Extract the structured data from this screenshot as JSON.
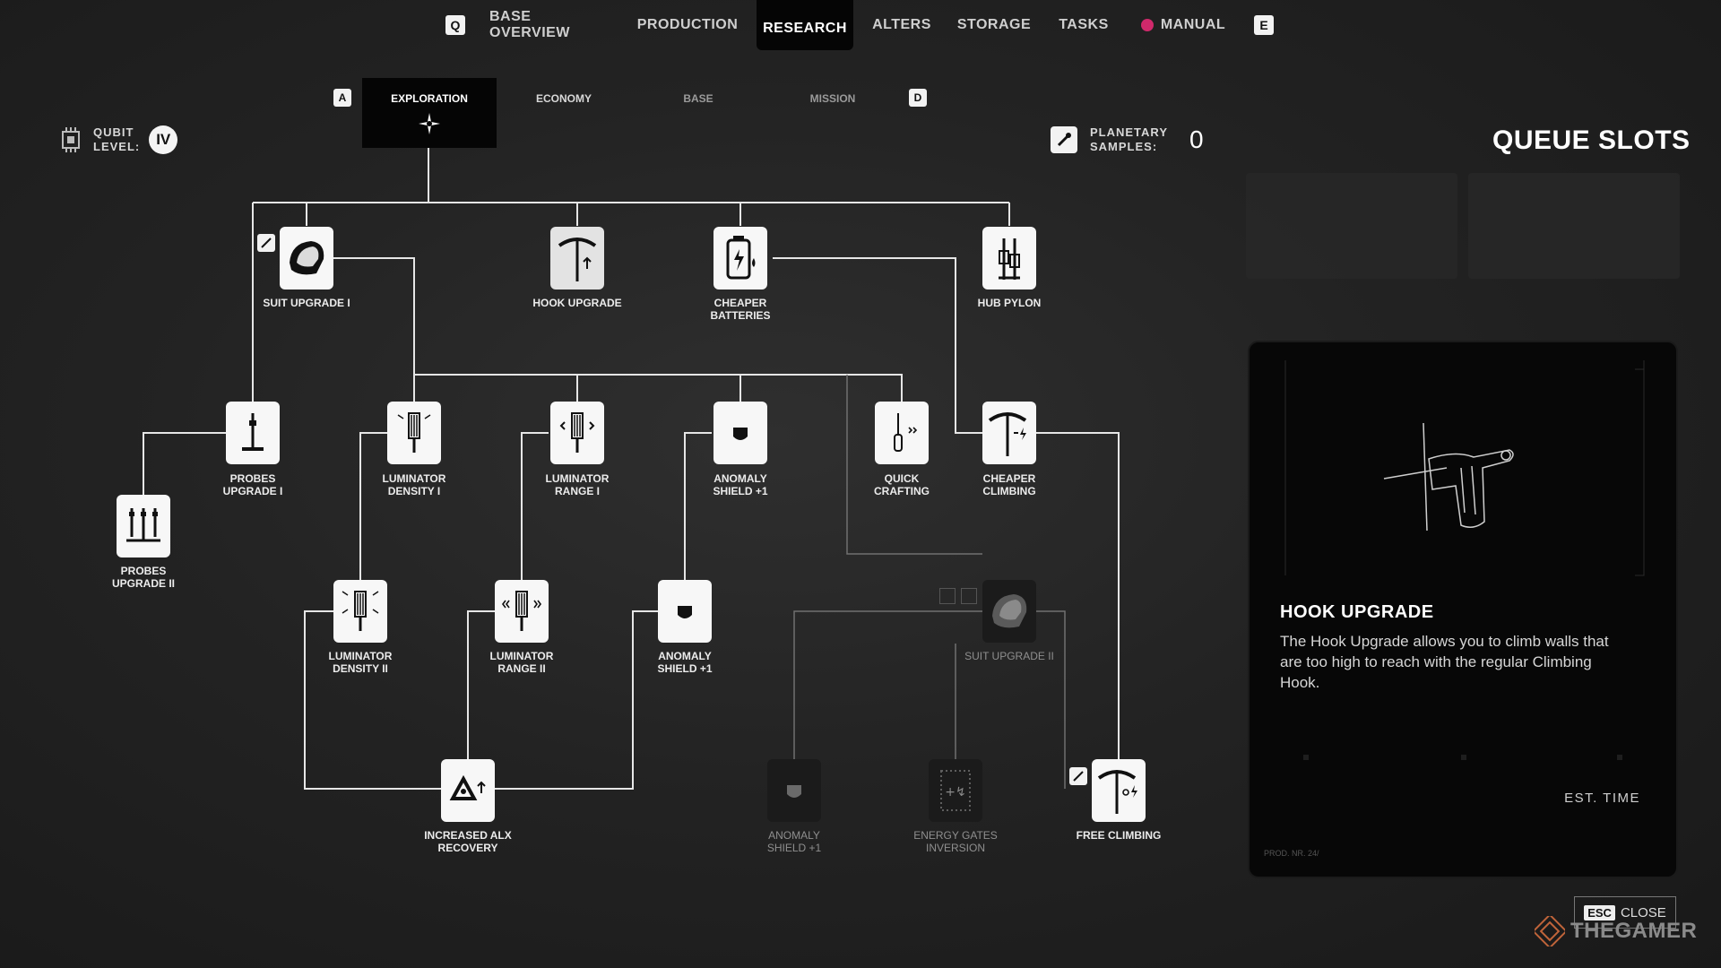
{
  "topnav": {
    "key_left": "Q",
    "key_right": "E",
    "items": [
      "BASE OVERVIEW",
      "PRODUCTION",
      "RESEARCH",
      "ALTERS",
      "STORAGE",
      "TASKS",
      "MANUAL"
    ],
    "active": "RESEARCH"
  },
  "subtabs": {
    "key_left": "A",
    "key_right": "D",
    "items": [
      "EXPLORATION",
      "ECONOMY",
      "BASE",
      "MISSION"
    ],
    "active": "EXPLORATION"
  },
  "qubit": {
    "label_line1": "QUBIT",
    "label_line2": "LEVEL:",
    "value": "IV"
  },
  "samples": {
    "label_line1": "PLANETARY",
    "label_line2": "SAMPLES:",
    "value": "0"
  },
  "queue": {
    "title": "QUEUE SLOTS"
  },
  "nodes": {
    "suit_upgrade_1": "SUIT UPGRADE I",
    "hook_upgrade": "HOOK UPGRADE",
    "cheaper_batteries_1": "CHEAPER",
    "cheaper_batteries_2": "BATTERIES",
    "hub_pylon": "HUB PYLON",
    "probes_upgrade_1_a": "PROBES",
    "probes_upgrade_1_b": "UPGRADE I",
    "luminator_density_1_a": "LUMINATOR",
    "luminator_density_1_b": "DENSITY I",
    "luminator_range_1_a": "LUMINATOR",
    "luminator_range_1_b": "RANGE I",
    "anomaly_shield_a_1": "ANOMALY",
    "anomaly_shield_a_2": "SHIELD +1",
    "quick_crafting_1": "QUICK",
    "quick_crafting_2": "CRAFTING",
    "cheaper_climbing_1": "CHEAPER",
    "cheaper_climbing_2": "CLIMBING",
    "probes_upgrade_2_a": "PROBES",
    "probes_upgrade_2_b": "UPGRADE II",
    "luminator_density_2_a": "LUMINATOR",
    "luminator_density_2_b": "DENSITY II",
    "luminator_range_2_a": "LUMINATOR",
    "luminator_range_2_b": "RANGE II",
    "anomaly_shield_b_1": "ANOMALY",
    "anomaly_shield_b_2": "SHIELD +1",
    "suit_upgrade_2": "SUIT UPGRADE II",
    "alx_recovery_1": "INCREASED ALX",
    "alx_recovery_2": "RECOVERY",
    "anomaly_shield_c_1": "ANOMALY",
    "anomaly_shield_c_2": "SHIELD +1",
    "energy_gates_1": "ENERGY GATES",
    "energy_gates_2": "INVERSION",
    "free_climbing": "FREE CLIMBING"
  },
  "info_panel": {
    "title": "HOOK UPGRADE",
    "description": "The Hook Upgrade allows you to climb walls that are too high to reach with the regular Climbing Hook.",
    "est_time_label": "EST. TIME",
    "prod_nr": "PROD. NR. 24/"
  },
  "close": {
    "key": "ESC",
    "label": "CLOSE"
  },
  "watermark": "THEGAMER",
  "colors": {
    "accent_pink": "#d0296b",
    "node_unlocked": "#f7f7f7",
    "node_locked": "#1b1b1b",
    "line": "#e6e6e6"
  }
}
